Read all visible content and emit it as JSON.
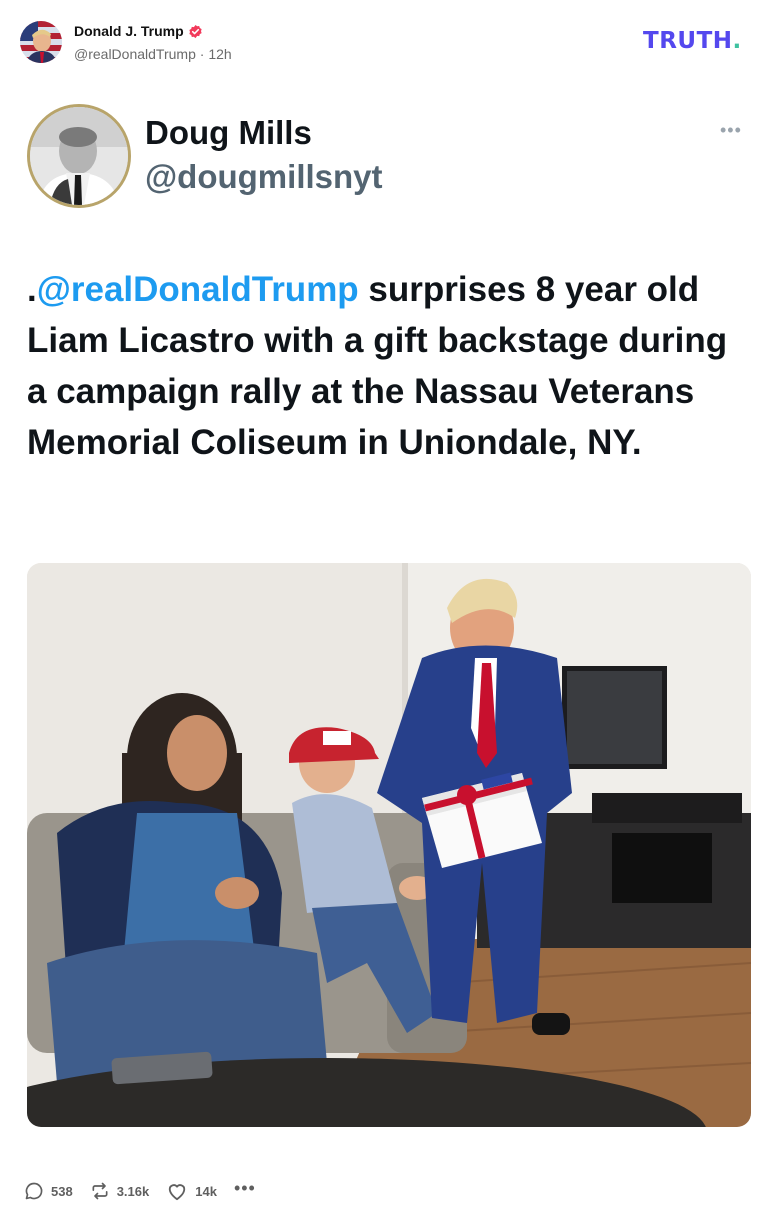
{
  "header": {
    "author_name": "Donald J. Trump",
    "author_handle": "@realDonaldTrump",
    "separator": "·",
    "posted_ago": "12h",
    "brand_word": "TRUTH",
    "brand_dot": ".",
    "verified_icon": "verified-badge-icon"
  },
  "embed": {
    "name": "Doug Mills",
    "handle": "@dougmillsnyt",
    "more_label": "•••",
    "text_prefix": ".",
    "text_mention": "@realDonaldTrump",
    "text_body": " surprises 8 year old Liam Licastro with a gift backstage during a campaign rally at the Nassau Veterans Memorial Coliseum in Uniondale, NY."
  },
  "actions": {
    "replies": "538",
    "retruths": "3.16k",
    "likes": "14k",
    "more_label": "•••"
  },
  "colors": {
    "brand": "#5448ee",
    "brand_dot": "#3ec2a0",
    "mention": "#1d9bf0",
    "verified": "#f23a5b"
  }
}
